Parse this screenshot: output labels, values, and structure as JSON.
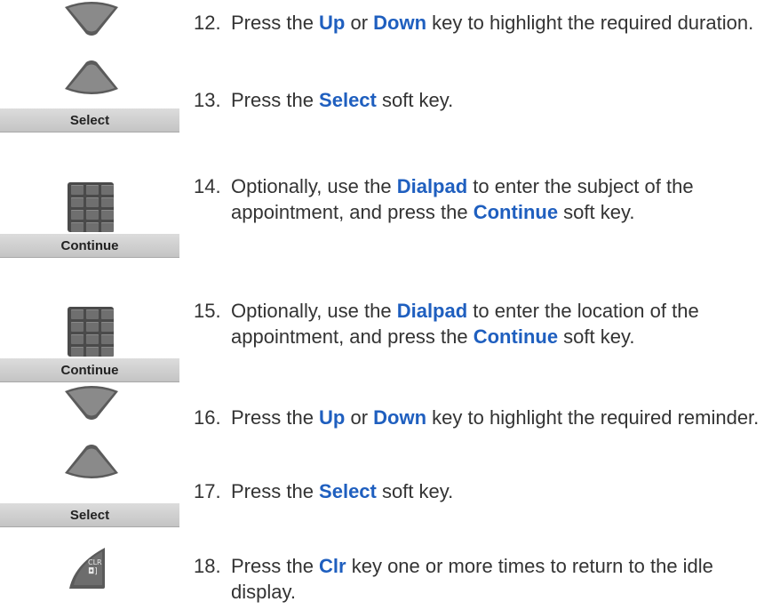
{
  "steps": [
    {
      "num": "12.",
      "pre": "Press the ",
      "k1": "Up",
      "mid": " or ",
      "k2": "Down",
      "post": " key to highlight the required duration."
    },
    {
      "num": "13.",
      "pre": "Press the ",
      "k1": "Select",
      "post": " soft key."
    },
    {
      "num": "14.",
      "pre": "Optionally, use the ",
      "k1": "Dialpad",
      "mid": " to enter the subject of the appointment, and press the ",
      "k2": "Continue",
      "post": " soft key."
    },
    {
      "num": "15.",
      "pre": "Optionally, use the ",
      "k1": "Dialpad",
      "mid": " to enter the location of the appointment, and press the ",
      "k2": "Continue",
      "post": " soft key."
    },
    {
      "num": "16.",
      "pre": "Press the ",
      "k1": "Up",
      "mid": " or ",
      "k2": "Down",
      "post": " key to highlight the required reminder."
    },
    {
      "num": "17.",
      "pre": "Press the ",
      "k1": "Select",
      "post": " soft key."
    },
    {
      "num": "18.",
      "pre": "Press the ",
      "k1": "Clr",
      "post": " key one or more times to return to the idle display."
    }
  ],
  "softkeys": {
    "select_1": "Select",
    "continue_1": "Continue",
    "continue_2": "Continue",
    "select_2": "Select"
  },
  "clr_key": {
    "line1": "CLR",
    "line2": "◘]"
  },
  "icons": [
    "nav-up-key-icon",
    "nav-down-key-icon",
    "dialpad-icon",
    "clr-key-icon"
  ]
}
